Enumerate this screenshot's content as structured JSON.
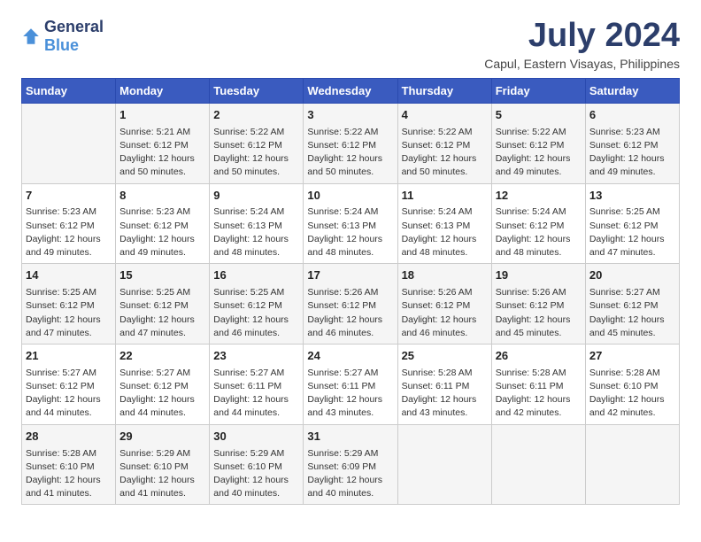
{
  "logo": {
    "general": "General",
    "blue": "Blue"
  },
  "title": "July 2024",
  "subtitle": "Capul, Eastern Visayas, Philippines",
  "days": [
    "Sunday",
    "Monday",
    "Tuesday",
    "Wednesday",
    "Thursday",
    "Friday",
    "Saturday"
  ],
  "weeks": [
    [
      {
        "day": "",
        "info": ""
      },
      {
        "day": "1",
        "info": "Sunrise: 5:21 AM\nSunset: 6:12 PM\nDaylight: 12 hours\nand 50 minutes."
      },
      {
        "day": "2",
        "info": "Sunrise: 5:22 AM\nSunset: 6:12 PM\nDaylight: 12 hours\nand 50 minutes."
      },
      {
        "day": "3",
        "info": "Sunrise: 5:22 AM\nSunset: 6:12 PM\nDaylight: 12 hours\nand 50 minutes."
      },
      {
        "day": "4",
        "info": "Sunrise: 5:22 AM\nSunset: 6:12 PM\nDaylight: 12 hours\nand 50 minutes."
      },
      {
        "day": "5",
        "info": "Sunrise: 5:22 AM\nSunset: 6:12 PM\nDaylight: 12 hours\nand 49 minutes."
      },
      {
        "day": "6",
        "info": "Sunrise: 5:23 AM\nSunset: 6:12 PM\nDaylight: 12 hours\nand 49 minutes."
      }
    ],
    [
      {
        "day": "7",
        "info": "Sunrise: 5:23 AM\nSunset: 6:12 PM\nDaylight: 12 hours\nand 49 minutes."
      },
      {
        "day": "8",
        "info": "Sunrise: 5:23 AM\nSunset: 6:12 PM\nDaylight: 12 hours\nand 49 minutes."
      },
      {
        "day": "9",
        "info": "Sunrise: 5:24 AM\nSunset: 6:13 PM\nDaylight: 12 hours\nand 48 minutes."
      },
      {
        "day": "10",
        "info": "Sunrise: 5:24 AM\nSunset: 6:13 PM\nDaylight: 12 hours\nand 48 minutes."
      },
      {
        "day": "11",
        "info": "Sunrise: 5:24 AM\nSunset: 6:13 PM\nDaylight: 12 hours\nand 48 minutes."
      },
      {
        "day": "12",
        "info": "Sunrise: 5:24 AM\nSunset: 6:12 PM\nDaylight: 12 hours\nand 48 minutes."
      },
      {
        "day": "13",
        "info": "Sunrise: 5:25 AM\nSunset: 6:12 PM\nDaylight: 12 hours\nand 47 minutes."
      }
    ],
    [
      {
        "day": "14",
        "info": "Sunrise: 5:25 AM\nSunset: 6:12 PM\nDaylight: 12 hours\nand 47 minutes."
      },
      {
        "day": "15",
        "info": "Sunrise: 5:25 AM\nSunset: 6:12 PM\nDaylight: 12 hours\nand 47 minutes."
      },
      {
        "day": "16",
        "info": "Sunrise: 5:25 AM\nSunset: 6:12 PM\nDaylight: 12 hours\nand 46 minutes."
      },
      {
        "day": "17",
        "info": "Sunrise: 5:26 AM\nSunset: 6:12 PM\nDaylight: 12 hours\nand 46 minutes."
      },
      {
        "day": "18",
        "info": "Sunrise: 5:26 AM\nSunset: 6:12 PM\nDaylight: 12 hours\nand 46 minutes."
      },
      {
        "day": "19",
        "info": "Sunrise: 5:26 AM\nSunset: 6:12 PM\nDaylight: 12 hours\nand 45 minutes."
      },
      {
        "day": "20",
        "info": "Sunrise: 5:27 AM\nSunset: 6:12 PM\nDaylight: 12 hours\nand 45 minutes."
      }
    ],
    [
      {
        "day": "21",
        "info": "Sunrise: 5:27 AM\nSunset: 6:12 PM\nDaylight: 12 hours\nand 44 minutes."
      },
      {
        "day": "22",
        "info": "Sunrise: 5:27 AM\nSunset: 6:12 PM\nDaylight: 12 hours\nand 44 minutes."
      },
      {
        "day": "23",
        "info": "Sunrise: 5:27 AM\nSunset: 6:11 PM\nDaylight: 12 hours\nand 44 minutes."
      },
      {
        "day": "24",
        "info": "Sunrise: 5:27 AM\nSunset: 6:11 PM\nDaylight: 12 hours\nand 43 minutes."
      },
      {
        "day": "25",
        "info": "Sunrise: 5:28 AM\nSunset: 6:11 PM\nDaylight: 12 hours\nand 43 minutes."
      },
      {
        "day": "26",
        "info": "Sunrise: 5:28 AM\nSunset: 6:11 PM\nDaylight: 12 hours\nand 42 minutes."
      },
      {
        "day": "27",
        "info": "Sunrise: 5:28 AM\nSunset: 6:10 PM\nDaylight: 12 hours\nand 42 minutes."
      }
    ],
    [
      {
        "day": "28",
        "info": "Sunrise: 5:28 AM\nSunset: 6:10 PM\nDaylight: 12 hours\nand 41 minutes."
      },
      {
        "day": "29",
        "info": "Sunrise: 5:29 AM\nSunset: 6:10 PM\nDaylight: 12 hours\nand 41 minutes."
      },
      {
        "day": "30",
        "info": "Sunrise: 5:29 AM\nSunset: 6:10 PM\nDaylight: 12 hours\nand 40 minutes."
      },
      {
        "day": "31",
        "info": "Sunrise: 5:29 AM\nSunset: 6:09 PM\nDaylight: 12 hours\nand 40 minutes."
      },
      {
        "day": "",
        "info": ""
      },
      {
        "day": "",
        "info": ""
      },
      {
        "day": "",
        "info": ""
      }
    ]
  ]
}
